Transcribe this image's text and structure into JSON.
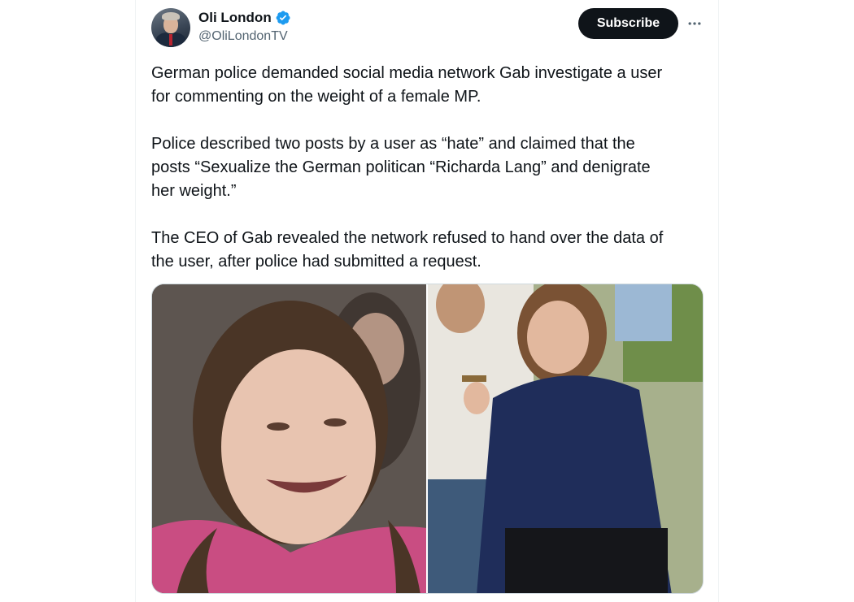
{
  "author": {
    "display_name": "Oli London",
    "handle": "@OliLondonTV",
    "verified": true,
    "verified_color": "#1d9bf0"
  },
  "actions": {
    "subscribe_label": "Subscribe",
    "more_icon": "more-horizontal-icon"
  },
  "tweet": {
    "paragraphs": [
      "German police demanded social media network Gab investigate a user\nfor commenting on the weight of a female MP.",
      "Police described two posts by a user as “hate” and claimed that the\nposts “Sexualize the German politican “Richarda Lang” and denigrate\nher weight.”",
      "The CEO of Gab revealed the network refused to hand over the data of\nthe user, after police had submitted a request."
    ]
  },
  "media": {
    "count": 2
  },
  "colors": {
    "text": "#0f1419",
    "secondary": "#536471",
    "button_bg": "#0f1419",
    "button_text": "#ffffff"
  }
}
